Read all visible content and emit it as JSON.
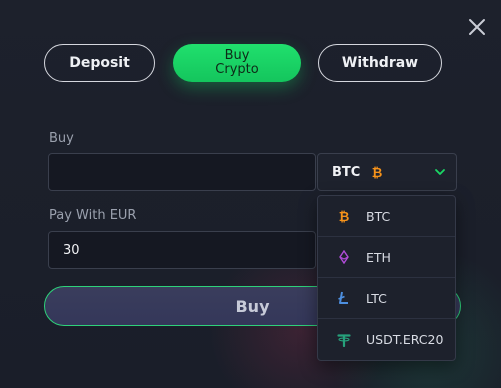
{
  "tabs": [
    {
      "label": "Deposit"
    },
    {
      "label": "Buy Crypto"
    },
    {
      "label": "Withdraw"
    }
  ],
  "buy": {
    "label": "Buy",
    "value": "",
    "currency": "BTC"
  },
  "pay": {
    "label": "Pay With EUR",
    "value": "30"
  },
  "buy_button": {
    "label": "Buy"
  },
  "currency_options": [
    {
      "label": "BTC",
      "icon": "bitcoin-icon",
      "color": "#f7931a"
    },
    {
      "label": "ETH",
      "icon": "ethereum-icon",
      "color": "#b04cd8"
    },
    {
      "label": "LTC",
      "icon": "litecoin-icon",
      "color": "#4d8fe0"
    },
    {
      "label": "USDT.ERC20",
      "icon": "tether-icon",
      "color": "#26a17b"
    }
  ],
  "colors": {
    "accent_green": "#1ad865",
    "background": "#1b1f2b"
  }
}
